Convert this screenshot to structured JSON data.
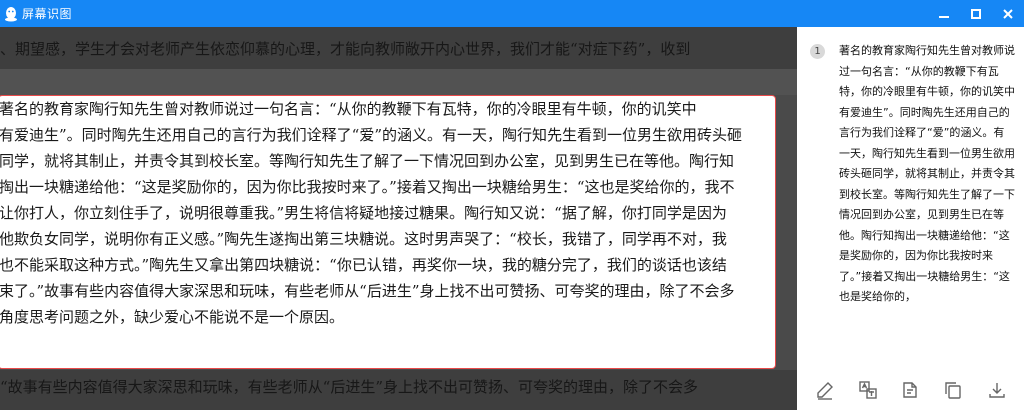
{
  "window": {
    "title": "屏幕识图"
  },
  "preview": {
    "top_text": "、期望感，学生才会对老师产生依恋仰慕的心理，才能向教师敞开内心世界，我们才能“对症下药”，收到",
    "selected_lines": [
      "    著名的教育家陶行知先生曾对教师说过一句名言：“从你的教鞭下有瓦特，你的冷眼里有牛顿，你的讥笑中",
      "有爱迪生”。同时陶先生还用自己的言行为我们诠释了“爱”的涵义。有一天，陶行知先生看到一位男生欲用砖头砸",
      "同学，就将其制止，并责令其到校长室。等陶行知先生了解了一下情况回到办公室，见到男生已在等他。陶行知",
      "掏出一块糖递给他：“这是奖励你的，因为你比我按时来了。”接着又掏出一块糖给男生：“这也是奖给你的，我不",
      "让你打人，你立刻住手了，说明很尊重我。”男生将信将疑地接过糖果。陶行知又说：“据了解，你打同学是因为",
      "他欺负女同学，说明你有正义感。”陶先生遂掏出第三块糖说。这时男声哭了：“校长，我错了，同学再不对，我",
      "也不能采取这种方式。”陶先生又拿出第四块糖说：“你已认错，再奖你一块，我的糖分完了，我们的谈话也该结",
      "束了。”故事有些内容值得大家深思和玩味，有些老师从“后进生”身上找不出可赞扬、可夸奖的理由，除了不会多",
      "角度思考问题之外，缺少爱心不能说不是一个原因。"
    ],
    "bottom_text": "“故事有些内容值得大家深思和玩味，有些老师从“后进生”身上找不出可赞扬、可夸奖的理由，除了不会多"
  },
  "result": {
    "number": "1",
    "text": "著名的教育家陶行知先生曾对教师说过一句名言：“从你的教鞭下有瓦特，你的冷眼里有牛顿，你的讥笑中有爱迪生”。同时陶先生还用自己的言行为我们诠释了“爱”的涵义。有一天，陶行知先生看到一位男生欲用砖头砸同学，就将其制止，并责令其到校长室。等陶行知先生了解了一下情况回到办公室，见到男生已在等他。陶行知掏出一块糖递给他：“这是奖励你的，因为你比我按时来了。”接着又掏出一块糖给男生：“这也是奖给你的，"
  },
  "colors": {
    "titlebar": "#1687f5",
    "selection_border": "#e94a4a",
    "icon_gray": "#666666"
  },
  "icons": [
    "qq-penguin-icon",
    "minimize-icon",
    "maximize-icon",
    "close-icon",
    "edit-icon",
    "translate-icon",
    "document-convert-icon",
    "copy-icon",
    "download-icon"
  ]
}
